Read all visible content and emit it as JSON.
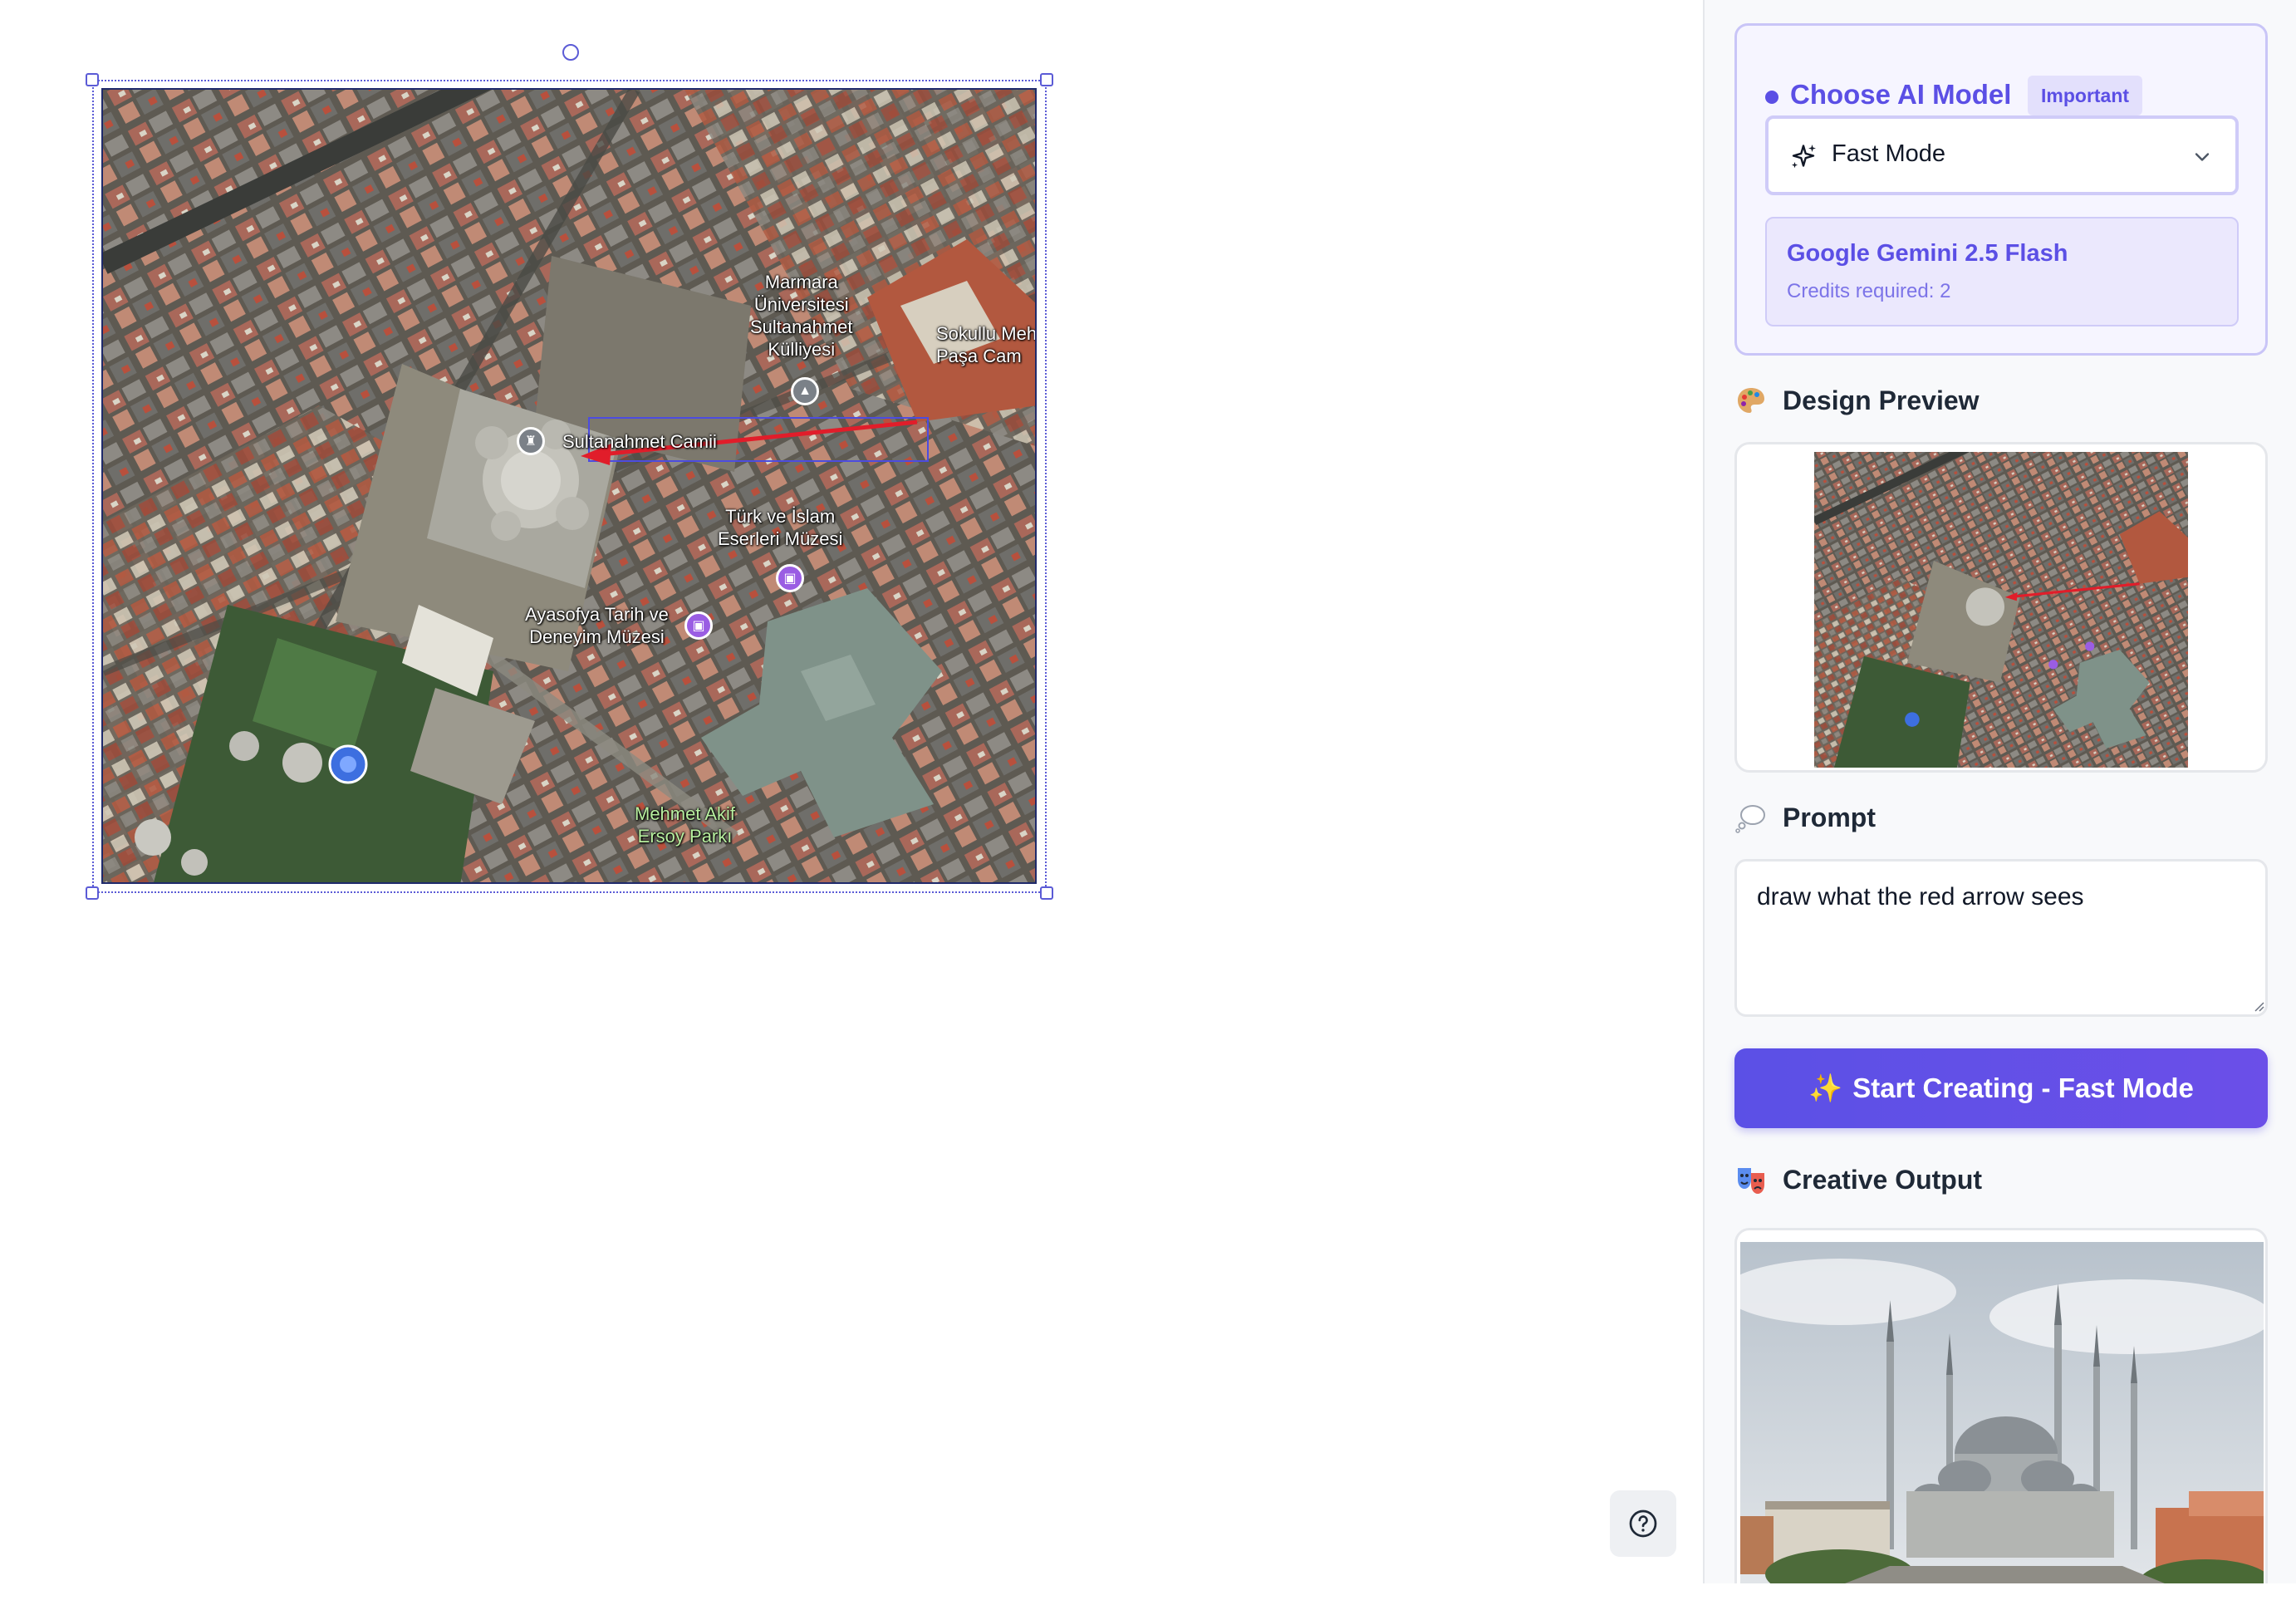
{
  "canvas": {
    "map_labels": {
      "marmara": "Marmara\nÜniversitesi\nSultanahmet\nKülliyesi",
      "sokullu": "Sokullu Meh\nPaşa Cam",
      "sultanahmet": "Sultanahmet Camii",
      "turk_islam": "Türk ve İslam\nEserleri Müzesi",
      "ayasofya": "Ayasofya Tarih ve\nDeneyim Müzesi",
      "mehmet_akif": "Mehmet Akif\nErsoy Parkı"
    },
    "help_icon": "question-circle-icon"
  },
  "sidebar": {
    "model_section": {
      "title": "Choose AI Model",
      "badge": "Important",
      "selected_mode": "Fast Mode",
      "model_name": "Google Gemini 2.5 Flash",
      "credits": "Credits required: 2"
    },
    "design_preview": {
      "title": "Design Preview",
      "icon": "palette-icon"
    },
    "prompt": {
      "title": "Prompt",
      "icon": "thought-bubble-icon",
      "value": "draw what the red arrow sees"
    },
    "start_button": {
      "icon": "sparkles-icon",
      "label": "Start Creating - Fast Mode"
    },
    "creative_output": {
      "title": "Creative Output",
      "icon": "theater-masks-icon"
    }
  },
  "colors": {
    "accent": "#5b4fe5",
    "accent_light": "#ebe8fd",
    "selection": "#5b5bd6",
    "arrow": "#e11d2a"
  }
}
